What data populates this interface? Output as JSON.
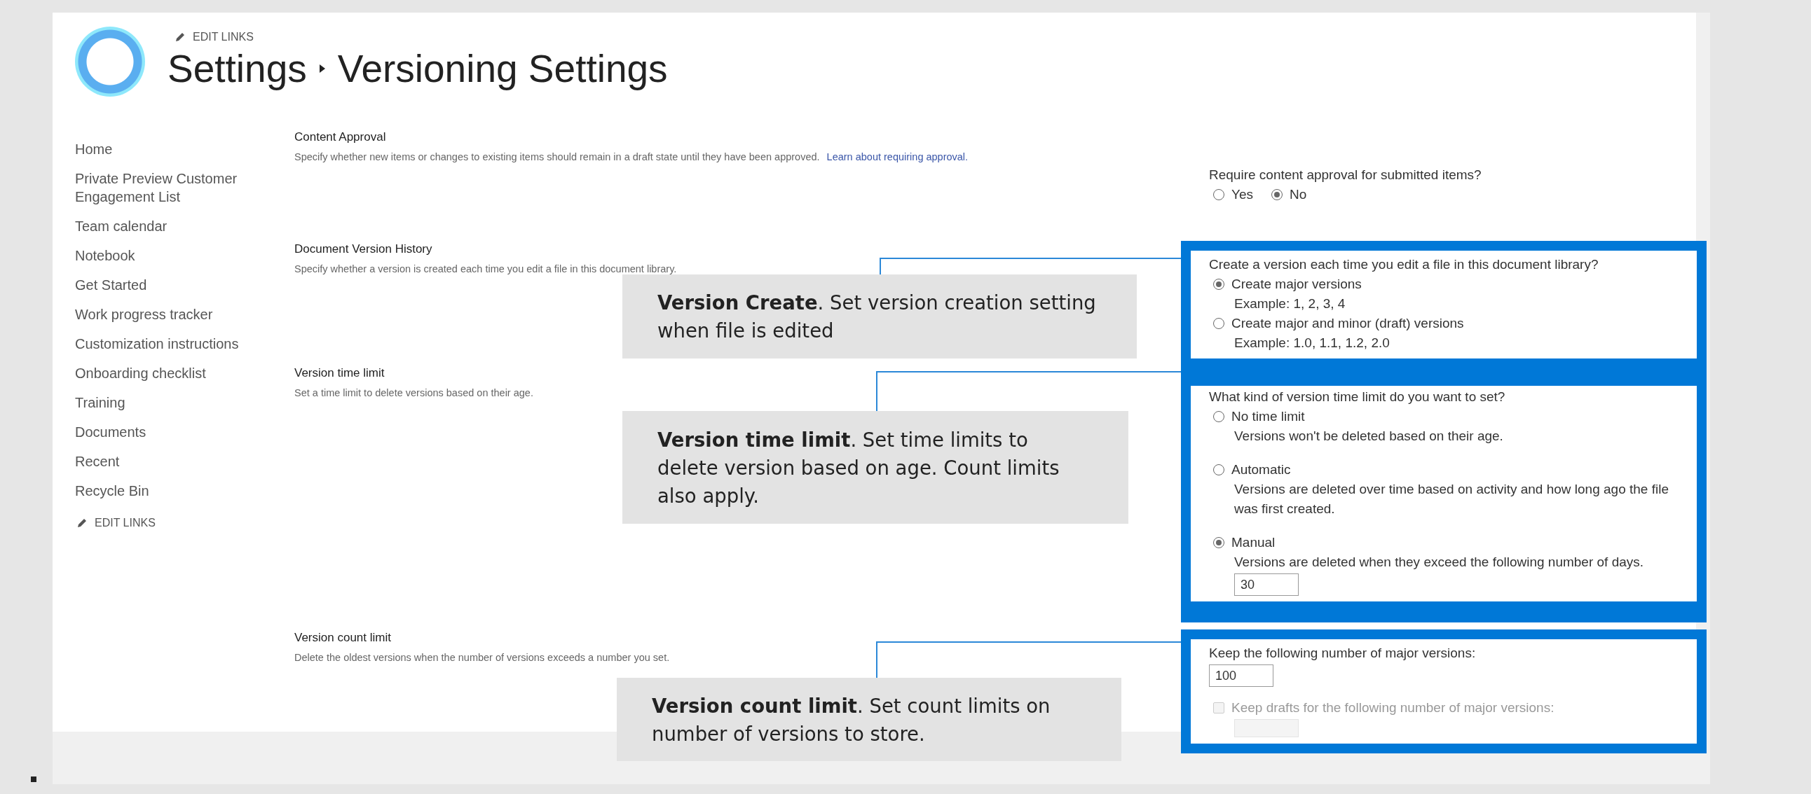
{
  "header": {
    "edit_links": "EDIT LINKS",
    "breadcrumb": [
      "Settings",
      "Versioning Settings"
    ]
  },
  "nav": {
    "items": [
      "Home",
      "Private Preview Customer Engagement List",
      "Team calendar",
      "Notebook",
      "Get Started",
      "Work progress tracker",
      "Customization instructions",
      "Onboarding checklist",
      "Training",
      "Documents",
      "Recent",
      "Recycle Bin"
    ],
    "edit_links": "EDIT LINKS"
  },
  "sections": [
    {
      "kind": "inline",
      "title": "Content Approval",
      "description": "Specify whether new items or changes to existing items should remain in a draft state until they have been approved.",
      "link": "Learn about requiring approval.",
      "question": "Require content approval for submitted items?",
      "options": [
        {
          "label": "Yes",
          "selected": false
        },
        {
          "label": "No",
          "selected": true
        }
      ]
    },
    {
      "kind": "list",
      "title": "Document Version History",
      "description": "Specify whether a version is created each time you edit a file in this document library.",
      "highlighted": true,
      "question": "Create a version each time you edit a file in this document library?",
      "options": [
        {
          "label": "Create major versions",
          "detail": "Example: 1, 2, 3, 4",
          "selected": true
        },
        {
          "label": "Create major and minor (draft) versions",
          "detail": "Example: 1.0, 1.1, 1.2, 2.0",
          "selected": false
        }
      ]
    },
    {
      "kind": "list",
      "title": "Version time limit",
      "description": "Set a time limit to delete versions based on their age.",
      "highlighted": true,
      "question": "What kind of version time limit do you want to set?",
      "options": [
        {
          "label": "No time limit",
          "detail": "Versions won't be deleted based on their age.",
          "selected": false
        },
        {
          "label": "Automatic",
          "detail": "Versions are deleted over time based on activity and how long ago the file was first created.",
          "selected": false
        },
        {
          "label": "Manual",
          "detail": "Versions are deleted when they exceed the following number of days.",
          "value": "30",
          "selected": true
        }
      ]
    },
    {
      "kind": "count",
      "title": "Version count limit",
      "description": "Delete the oldest versions when the number of versions exceeds a number you set.",
      "highlighted": true,
      "question": "Keep the following number of major versions:",
      "value": "100",
      "drafts": {
        "label": "Keep drafts for the following number of major versions:",
        "checked": false,
        "disabled": true
      }
    }
  ],
  "callouts": [
    {
      "text": "**Version Create**. Set version creation setting when file is edited"
    },
    {
      "text": "**Version time limit**. Set time limits to delete version based on age.  Count limits also apply."
    },
    {
      "text": "**Version count limit**. Set count limits on number of versions to store."
    }
  ]
}
